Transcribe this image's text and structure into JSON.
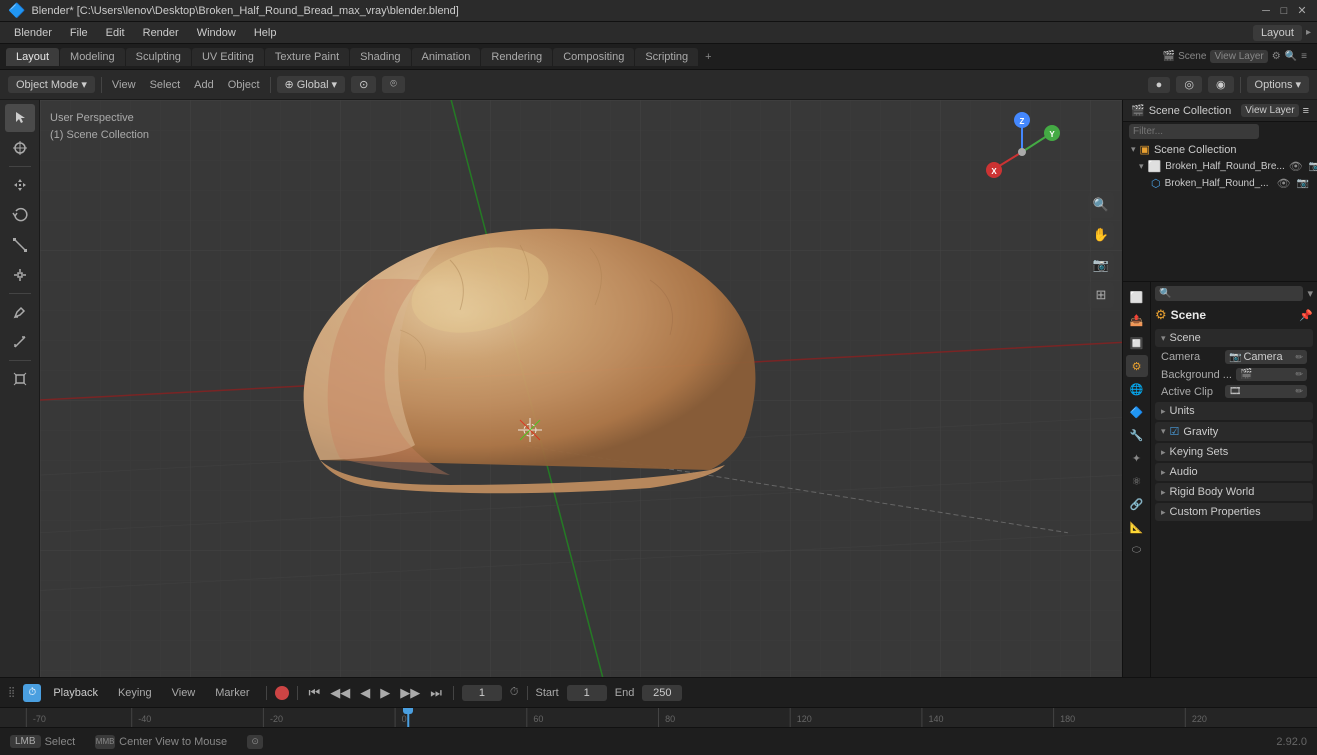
{
  "titlebar": {
    "title": "Blender* [C:\\Users\\lenov\\Desktop\\Broken_Half_Round_Bread_max_vray\\blender.blend]",
    "icon": "🔷"
  },
  "menubar": {
    "items": [
      "Blender",
      "File",
      "Edit",
      "Render",
      "Window",
      "Help"
    ]
  },
  "workspaces": {
    "tabs": [
      "Layout",
      "Modeling",
      "Sculpting",
      "UV Editing",
      "Texture Paint",
      "Shading",
      "Animation",
      "Rendering",
      "Compositing",
      "Scripting"
    ],
    "active": "Layout",
    "add_label": "+"
  },
  "top_toolbar": {
    "mode": "Object Mode",
    "view": "View",
    "select": "Select",
    "add": "Add",
    "object": "Object",
    "transform": "Global",
    "snap": "⊙",
    "options": "Options"
  },
  "viewport": {
    "info_line1": "User Perspective",
    "info_line2": "(1) Scene Collection"
  },
  "view_layer": {
    "title": "View Layer",
    "name": "View Layer"
  },
  "outliner": {
    "title": "Scene Collection",
    "items": [
      {
        "label": "Broken_Half_Round_Bre...",
        "indent": 0,
        "eye": true,
        "arrow": true
      },
      {
        "label": "Broken_Half_Round_...",
        "indent": 1,
        "eye": true,
        "arrow": false
      }
    ]
  },
  "properties": {
    "scene_title": "Scene",
    "scene_section": "Scene",
    "camera_label": "Camera",
    "camera_value": "Camera",
    "background_label": "Background ...",
    "active_clip_label": "Active Clip",
    "units_label": "Units",
    "gravity_label": "Gravity",
    "gravity_checked": true,
    "keying_sets_label": "Keying Sets",
    "audio_label": "Audio",
    "rigid_body_label": "Rigid Body World",
    "custom_props_label": "Custom Properties"
  },
  "timeline": {
    "playback_label": "Playback",
    "keying_label": "Keying",
    "view_label": "View",
    "marker_label": "Marker",
    "current_frame": "1",
    "start_label": "Start",
    "start_frame": "1",
    "end_label": "End",
    "end_frame": "250"
  },
  "statusbar": {
    "select_key": "LMB",
    "select_label": "Select",
    "center_key": "MMB",
    "center_label": "Center View to Mouse",
    "version": "2.92.0"
  },
  "icons": {
    "arrow_down": "▾",
    "arrow_right": "▸",
    "eye": "👁",
    "camera": "📷",
    "scene": "🎬",
    "render": "⬜",
    "output": "📤",
    "view_layer": "🔲",
    "scene_prop": "⚙",
    "world": "🌐",
    "object": "🔷",
    "modifier": "🔧",
    "particles": "✦",
    "physics": "⚛",
    "constraint": "🔗",
    "data": "📐",
    "material": "⬭",
    "close": "✕",
    "minimize": "─",
    "maximize": "□",
    "search": "🔍",
    "pin": "📌",
    "filter": "≡",
    "checkbox_checked": "☑",
    "checkbox_unchecked": "☐"
  }
}
